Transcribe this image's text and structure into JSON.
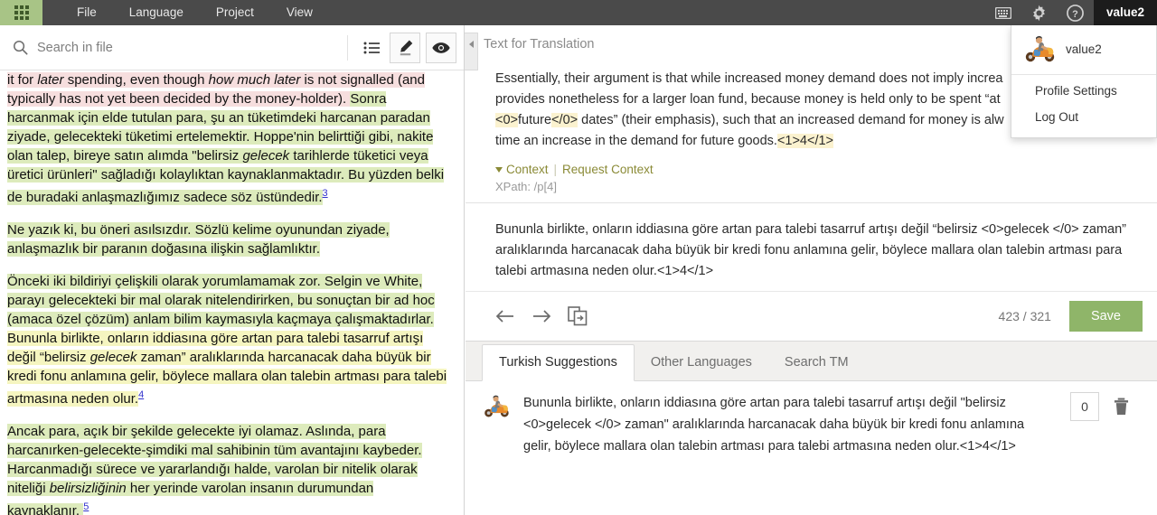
{
  "topbar": {
    "grid_icon": "apps-grid-icon",
    "menu": [
      {
        "label": "File"
      },
      {
        "label": "Language"
      },
      {
        "label": "Project"
      },
      {
        "label": "View"
      }
    ],
    "icons": [
      {
        "name": "keyboard-icon"
      },
      {
        "name": "gear-icon"
      },
      {
        "name": "help-icon"
      }
    ],
    "user_label": "value2",
    "colors": {
      "bar": "#4a4a4a",
      "grid_bg": "#a8c486",
      "user_chip": "#1c1c1c"
    }
  },
  "user_menu": {
    "avatar_icon": "scooter-avatar-icon",
    "name": "value2",
    "items": [
      {
        "label": "Profile Settings"
      },
      {
        "label": "Log Out"
      }
    ]
  },
  "left_pane": {
    "search": {
      "icon": "search-icon",
      "placeholder": "Search in file",
      "value": ""
    },
    "tools": [
      {
        "name": "list-view-icon"
      },
      {
        "name": "edit-pencil-icon"
      },
      {
        "name": "preview-eye-icon"
      }
    ],
    "document": {
      "p1_a": "it for ",
      "p1_a_i": "later",
      "p1_b": " spending, even though ",
      "p1_b_i": "how much later",
      "p1_c": " is not signalled (and typically has not yet been decided by the money-holder). ",
      "p1_green_a": "Sonra harcanmak için elde tutulan para, şu an tüketimdeki harcanan paradan ziyade, gelecekteki tüketimi ertelemektir. Hoppe'nin belirttiği gibi, nakite olan talep, bireye satın alımda \"belirsiz ",
      "p1_green_i": "gelecek",
      "p1_green_b": " tarihlerde tüketici veya üretici ürünleri\" sağladığı kolaylıktan kaynaklanmaktadır. Bu yüzden belki de buradaki anlaşmazlığımız sadece söz üstündedir.",
      "p1_fn": "3",
      "p2": "Ne yazık ki, bu öneri asılsızdır. Sözlü kelime oyunundan ziyade, anlaşmazlık bir paranın doğasına ilişkin sağlamlıktır.",
      "p3_green": "Önceki iki bildiriyi çelişkili olarak yorumlamamak zor. Selgin ve White, parayı gelecekteki bir mal olarak nitelendirirken, bu sonuçtan bir ad hoc (amaca özel çözüm) anlam bilim kaymasıyla kaçmaya çalışmaktadırlar. ",
      "p3_yellow_a": "Bununla birlikte, onların iddiasına göre artan para talebi tasarruf artışı değil “belirsiz ",
      "p3_yellow_i": "gelecek",
      "p3_yellow_b": " zaman” aralıklarında harcanacak daha büyük bir kredi fonu anlamına gelir, böylece mallara olan talebin artması para talebi artmasına neden olur.",
      "p3_fn": "4",
      "p4_a": "Ancak para, açık bir şekilde gelecekte iyi olamaz. Aslında, para harcanırken-gelecekte-şimdiki mal sahibinin tüm avantajını kaybeder. Harcanmadığı sürece ve yararlandığı halde, varolan bir nitelik olarak niteliği ",
      "p4_i": "belirsizliğinin",
      "p4_b": " her yerinde varolan insanın durumundan kaynaklanır. ",
      "p4_fn": "5"
    }
  },
  "right_pane": {
    "collapse_icon": "collapse-left-icon",
    "source_label": "Text for Translation",
    "source_text": {
      "a": "Essentially, their argument is that while increased money demand does not imply increa",
      "b": "provides nonetheless for a larger loan fund, because money is held only to be spent “at ",
      "tag_open": "<0>",
      "c": "future",
      "tag_close": "</0>",
      "d": " dates” (their emphasis), such that an increased demand for money is alw",
      "e": "time an increase in the demand for future goods.",
      "tag_ref": "<1>4</1>"
    },
    "context": {
      "label": "Context",
      "request_label": "Request Context",
      "separator": "|",
      "xpath": "XPath: /p[4]"
    },
    "target_text": "Bununla birlikte, onların iddiasına göre artan para talebi tasarruf artışı değil “belirsiz <0>gelecek </0> zaman” aralıklarında harcanacak daha büyük bir kredi fonu anlamına gelir, böylece mallara olan talebin artması para talebi artmasına neden olur.<1>4</1>",
    "edit_bar": {
      "prev_icon": "arrow-left-icon",
      "next_icon": "arrow-right-icon",
      "copy_icon": "copy-source-icon",
      "counter": "423 / 321",
      "save_label": "Save",
      "save_color": "#8fb569"
    },
    "tabs": [
      {
        "label": "Turkish Suggestions",
        "active": true
      },
      {
        "label": "Other Languages",
        "active": false
      },
      {
        "label": "Search TM",
        "active": false
      }
    ],
    "suggestion": {
      "avatar_icon": "scooter-avatar-icon",
      "text": "Bununla birlikte, onların iddiasına göre artan para talebi tasarruf artışı değil \"belirsiz <0>gelecek </0> zaman\" aralıklarında harcanacak daha büyük bir kredi fonu anlamına gelir, böylece mallara olan talebin artması para talebi artmasına neden olur.<1>4</1>",
      "score": "0",
      "delete_icon": "trash-icon"
    }
  }
}
